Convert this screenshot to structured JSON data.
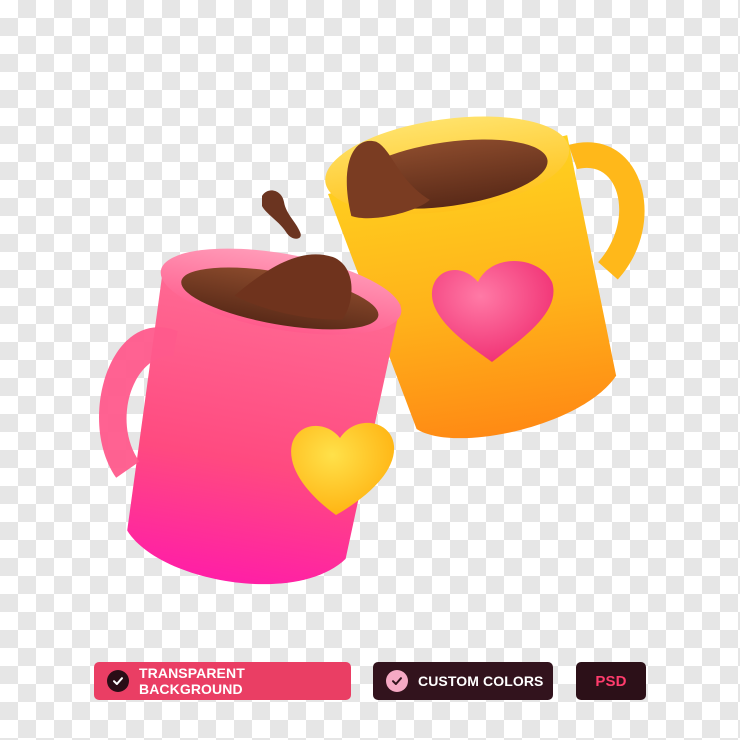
{
  "badges": {
    "transparent_background": "TRANSPARENT BACKGROUND",
    "custom_colors": "CUSTOM COLORS",
    "psd": "PSD"
  },
  "icons": [
    "check-icon",
    "check-icon"
  ],
  "colors": {
    "pink_badge": "#ea3e64",
    "dark_badge": "#32131d",
    "psd_text": "#ff3c6c",
    "pink_mug": "#ff4f8b",
    "yellow_mug": "#ffc21a",
    "coffee": "#6b3420"
  }
}
